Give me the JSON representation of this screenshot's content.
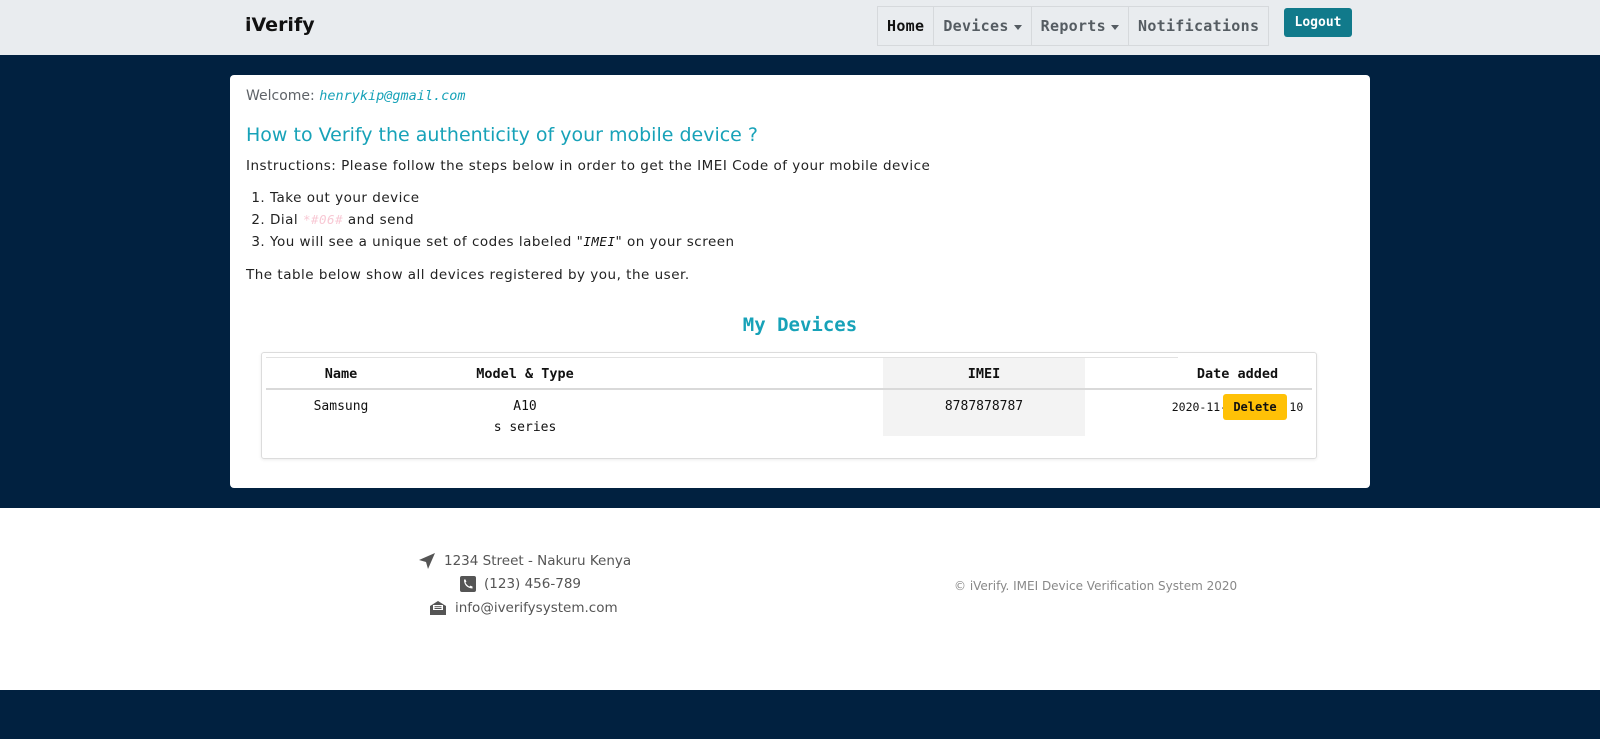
{
  "navbar": {
    "brand": "iVerify",
    "items": [
      {
        "label": "Home"
      },
      {
        "label": "Devices"
      },
      {
        "label": "Reports"
      },
      {
        "label": "Notifications"
      }
    ],
    "logout_label": "Logout"
  },
  "main": {
    "welcome_label": "Welcome:",
    "welcome_email": "henrykip@gmail.com",
    "heading": "How to Verify the authenticity of your mobile device ?",
    "instructions": "Instructions: Please follow the steps below in order to get the IMEI Code of your mobile device",
    "steps": {
      "step1": "Take out your device",
      "step2_prefix": "Dial",
      "step2_code": "*#06#",
      "step2_suffix": "and send",
      "step3_prefix": "You will see a unique set of codes labeled \"",
      "step3_tag": "IMEI",
      "step3_suffix": "\" on your screen"
    },
    "table_note": "The table below show all devices registered by you, the user.",
    "devices_title": "My Devices",
    "table": {
      "headers": [
        "Name",
        "Model & Type",
        "IMEI",
        "Date added"
      ],
      "rows": [
        {
          "name": "Samsung",
          "model_line1": "A10",
          "model_line2": "s series",
          "imei": "8787878787",
          "date_added": "2020-11-10 14:21:10",
          "delete_label": "Delete"
        }
      ]
    }
  },
  "footer": {
    "address": "1234 Street - Nakuru Kenya",
    "phone": "(123) 456-789",
    "email": "info@iverifysystem.com",
    "copyright": "© iVerify. IMEI Device Verification System 2020"
  },
  "colors": {
    "navbar_bg": "#e9ecef",
    "band_bg": "#012140",
    "accent": "#17a2b8",
    "logout_bg": "#117a8b",
    "delete_bg": "#ffc107"
  },
  "icons": [
    "location-arrow-icon",
    "phone-icon",
    "envelope-open-icon",
    "caret-down-icon"
  ]
}
